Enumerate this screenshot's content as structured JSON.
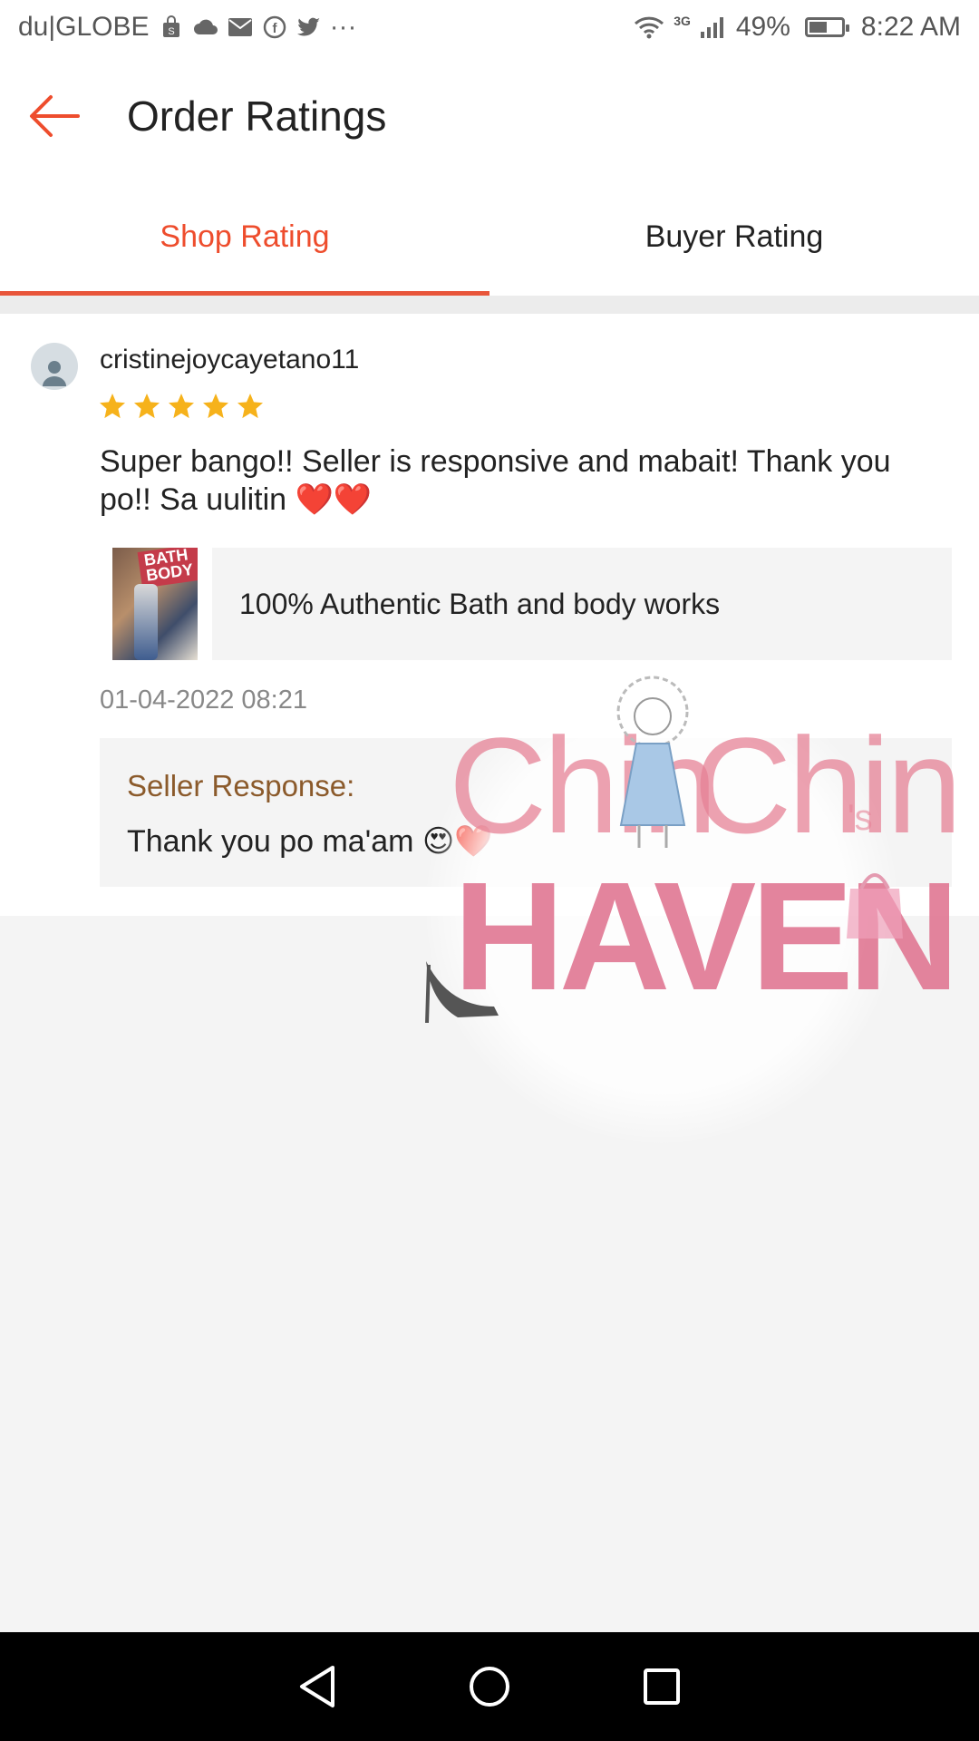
{
  "status_bar": {
    "carrier": "du|GLOBE",
    "network_badge": "3G",
    "battery_text": "49%",
    "battery_level": 0.49,
    "time": "8:22 AM",
    "notification_icons": [
      "shopping-bag-icon",
      "cloud-icon",
      "mail-icon",
      "facebook-icon",
      "twitter-icon",
      "more-icon"
    ],
    "overflow_glyph": "···"
  },
  "header": {
    "title": "Order Ratings"
  },
  "tabs": [
    {
      "label": "Shop Rating",
      "active": true
    },
    {
      "label": "Buyer Rating",
      "active": false
    }
  ],
  "review": {
    "username": "cristinejoycayetano11",
    "rating": 5,
    "max_rating": 5,
    "text": "Super bango!! Seller is responsive and mabait! Thank you po!! Sa uulitin ❤️❤️",
    "product_name": "100% Authentic Bath and body works",
    "product_thumb_text": "BATH BODY",
    "date": "01-04-2022 08:21",
    "seller_response_label": "Seller Response:",
    "seller_response_text": "Thank you po ma'am 😍❤️"
  },
  "watermark": {
    "word_left": "Chin",
    "word_right": "Chin",
    "suffix": "'s",
    "word_bottom": "HAVEN"
  },
  "colors": {
    "accent": "#ee4d2d",
    "star": "#f6b21b",
    "response_label": "#8b5a2b"
  }
}
